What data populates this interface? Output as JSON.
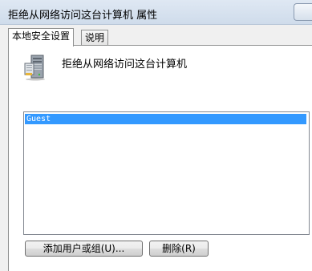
{
  "window": {
    "title": "拒绝从网络访问这台计算机 属性"
  },
  "tabs": [
    {
      "label": "本地安全设置",
      "active": true
    },
    {
      "label": "说明",
      "active": false
    }
  ],
  "policy": {
    "icon": "server-computer-icon",
    "name": "拒绝从网络访问这台计算机"
  },
  "accounts": {
    "items": [
      "Guest"
    ],
    "selected": "Guest",
    "selection_color": "#3399ff"
  },
  "buttons": {
    "add_label": "添加用户或组(U)...",
    "remove_label": "删除(R)"
  }
}
